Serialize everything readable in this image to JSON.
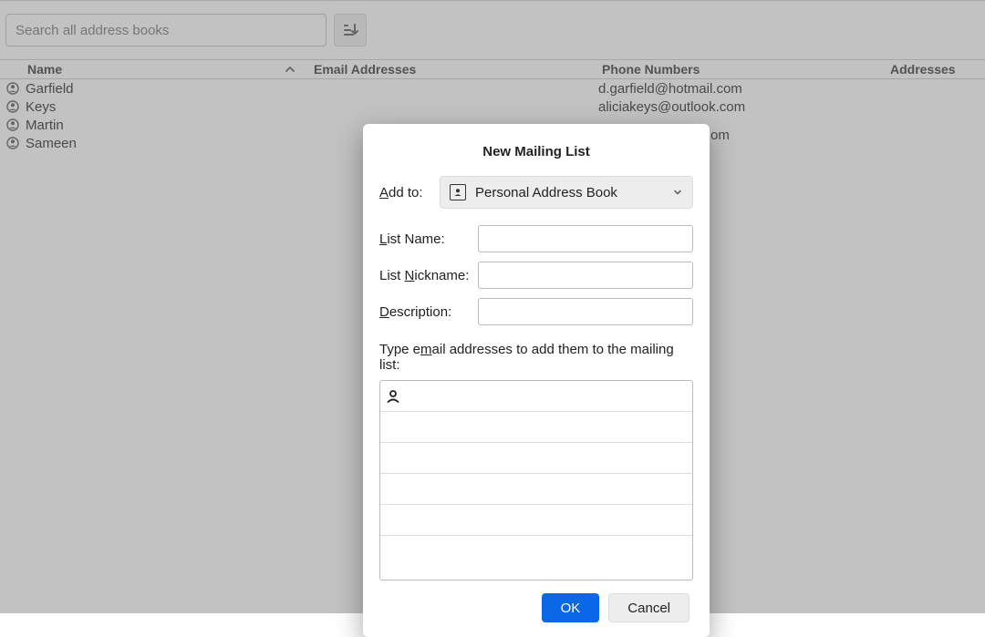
{
  "toolbar": {
    "search_placeholder": "Search all address books"
  },
  "columns": {
    "name": "Name",
    "email": "Email Addresses",
    "phone": "Phone Numbers",
    "addresses": "Addresses"
  },
  "contacts": [
    {
      "name": "Garfield",
      "email": "",
      "phone": "d.garfield@hotmail.com",
      "address": ""
    },
    {
      "name": "Keys",
      "email": "",
      "phone": "aliciakeys@outlook.com",
      "address": ""
    },
    {
      "name": "Martin",
      "email": "",
      "phone": "",
      "address": ""
    },
    {
      "name": "Sameen",
      "email": "",
      "phone": "",
      "address": ""
    }
  ],
  "partial_phone_suffix": "om",
  "dialog": {
    "title": "New Mailing List",
    "add_to_label": "Add to:",
    "add_to_value": "Personal Address Book",
    "list_name_label": "List Name:",
    "list_nickname_label": "List Nickname:",
    "description_label": "Description:",
    "instruction": "Type email addresses to add them to the mailing list:",
    "list_name_value": "",
    "list_nickname_value": "",
    "description_value": "",
    "ok_label": "OK",
    "cancel_label": "Cancel"
  }
}
